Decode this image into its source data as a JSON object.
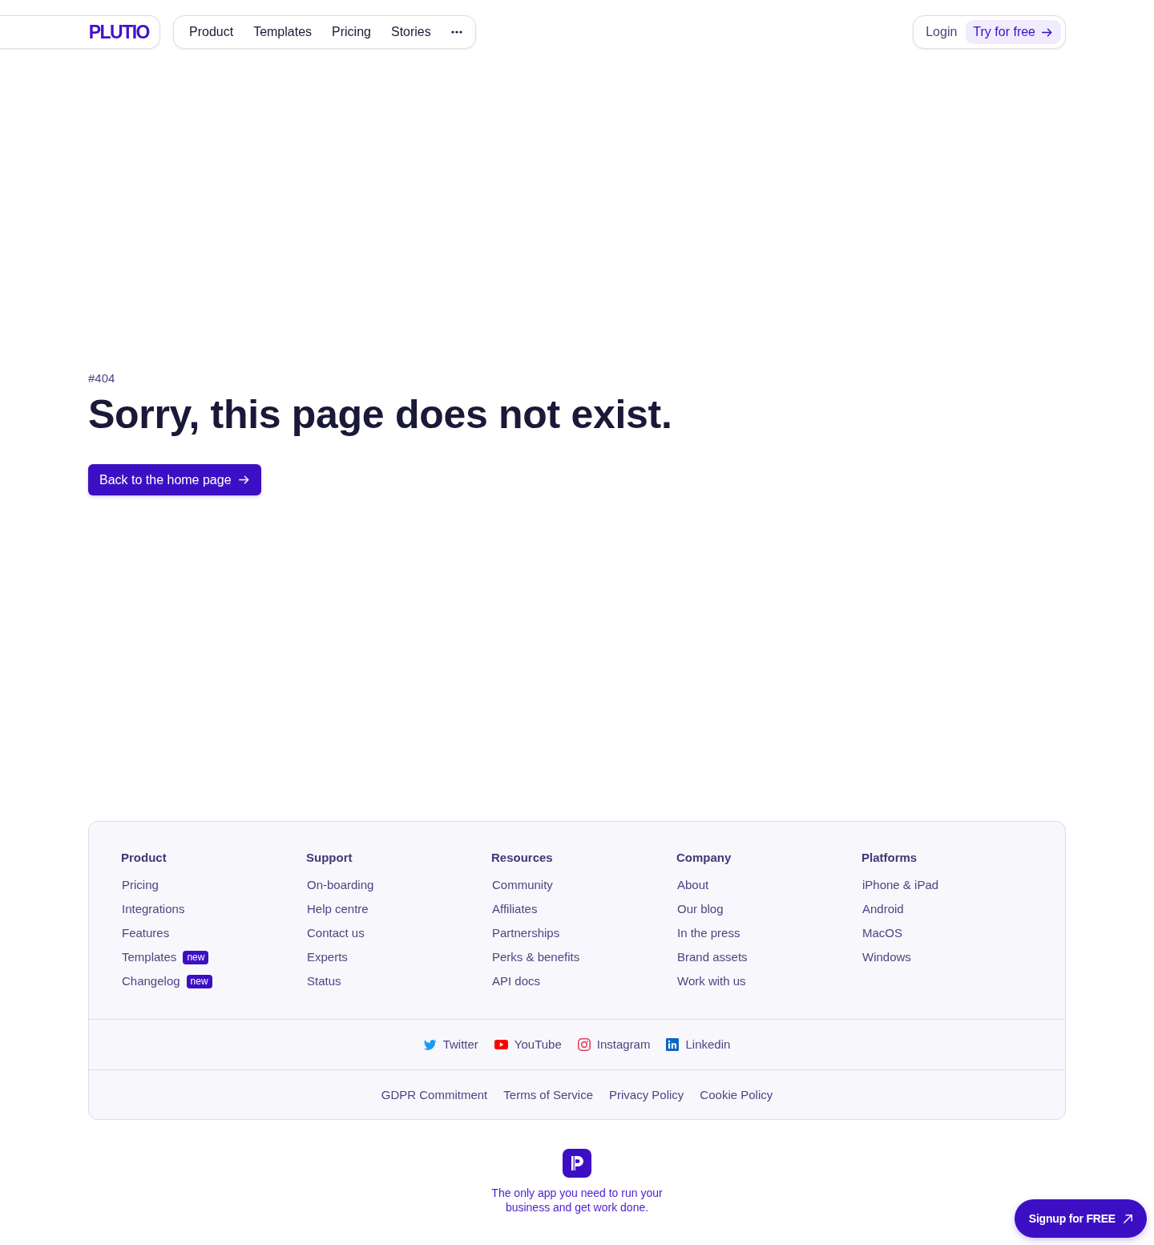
{
  "header": {
    "logo": "PLUTIO",
    "nav": [
      "Product",
      "Templates",
      "Pricing",
      "Stories"
    ],
    "login": "Login",
    "cta": "Try for free"
  },
  "hero": {
    "code": "#404",
    "title": "Sorry, this page does not exist.",
    "button": "Back to the home page"
  },
  "footer": {
    "columns": [
      {
        "heading": "Product",
        "links": [
          {
            "label": "Pricing"
          },
          {
            "label": "Integrations"
          },
          {
            "label": "Features"
          },
          {
            "label": "Templates",
            "badge": "new"
          },
          {
            "label": "Changelog",
            "badge": "new"
          }
        ]
      },
      {
        "heading": "Support",
        "links": [
          {
            "label": "On-boarding"
          },
          {
            "label": "Help centre"
          },
          {
            "label": "Contact us"
          },
          {
            "label": "Experts"
          },
          {
            "label": "Status"
          }
        ]
      },
      {
        "heading": "Resources",
        "links": [
          {
            "label": "Community"
          },
          {
            "label": "Affiliates"
          },
          {
            "label": "Partnerships"
          },
          {
            "label": "Perks & benefits"
          },
          {
            "label": "API docs"
          }
        ]
      },
      {
        "heading": "Company",
        "links": [
          {
            "label": "About"
          },
          {
            "label": "Our blog"
          },
          {
            "label": "In the press"
          },
          {
            "label": "Brand assets"
          },
          {
            "label": "Work with us"
          }
        ]
      },
      {
        "heading": "Platforms",
        "links": [
          {
            "label": "iPhone & iPad"
          },
          {
            "label": "Android"
          },
          {
            "label": "MacOS"
          },
          {
            "label": "Windows"
          }
        ]
      }
    ],
    "social": [
      {
        "kind": "twitter",
        "label": "Twitter"
      },
      {
        "kind": "youtube",
        "label": "YouTube"
      },
      {
        "kind": "instagram",
        "label": "Instagram"
      },
      {
        "kind": "linkedin",
        "label": "Linkedin"
      }
    ],
    "legal": [
      "GDPR Commitment",
      "Terms of Service",
      "Privacy Policy",
      "Cookie Policy"
    ]
  },
  "tagline": "The only app you need to run your business and get work done.",
  "signup_button": "Signup for FREE"
}
